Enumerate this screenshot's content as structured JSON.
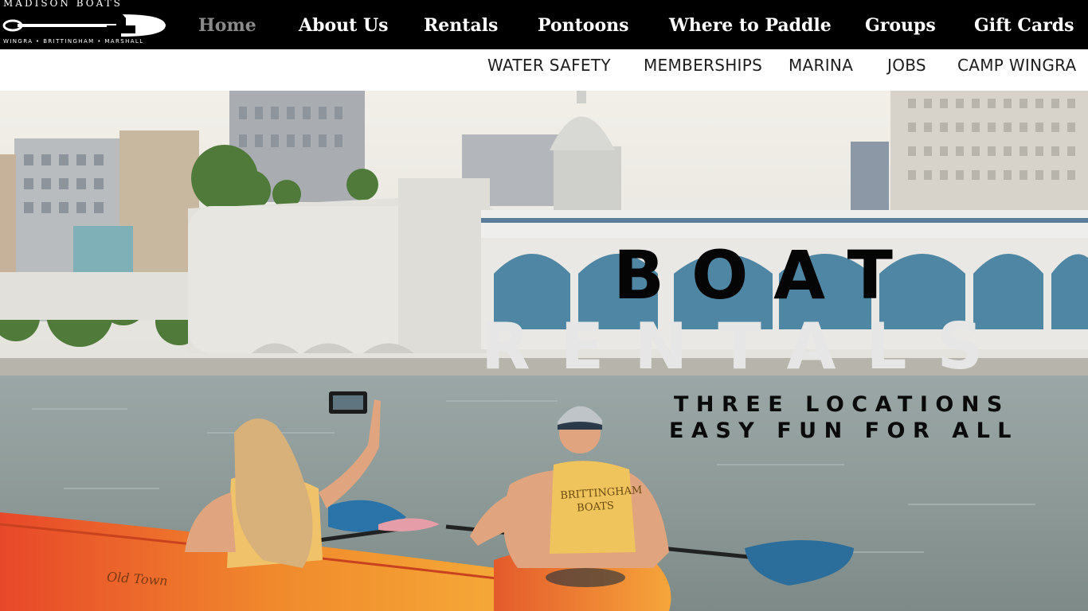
{
  "brand": {
    "name": "MADISON BOATS",
    "locations": "WINGRA • BRITTINGHAM • MARSHALL"
  },
  "main_nav": [
    {
      "label": "Home",
      "active": true
    },
    {
      "label": "About Us",
      "active": false
    },
    {
      "label": "Rentals",
      "active": false
    },
    {
      "label": "Pontoons",
      "active": false
    },
    {
      "label": "Where to Paddle",
      "active": false
    },
    {
      "label": "Groups",
      "active": false
    },
    {
      "label": "Gift Cards",
      "active": false
    }
  ],
  "sub_nav": [
    {
      "label": "WATER SAFETY"
    },
    {
      "label": "MEMBERSHIPS"
    },
    {
      "label": "MARINA"
    },
    {
      "label": "JOBS"
    },
    {
      "label": "CAMP WINGRA"
    }
  ],
  "hero": {
    "headline_line1": "BOAT",
    "headline_line2": "RENTALS",
    "tagline_line1": "THREE LOCATIONS",
    "tagline_line2": "EASY FUN FOR ALL",
    "kayak_brand": "Old Town",
    "vest_text": "BRITTINGHAM BOATS"
  },
  "colors": {
    "nav_background": "#000000",
    "nav_text": "#ffffff",
    "nav_active": "#8a8a8a",
    "headline_dark": "#050505",
    "headline_light": "#e6e6e6"
  }
}
